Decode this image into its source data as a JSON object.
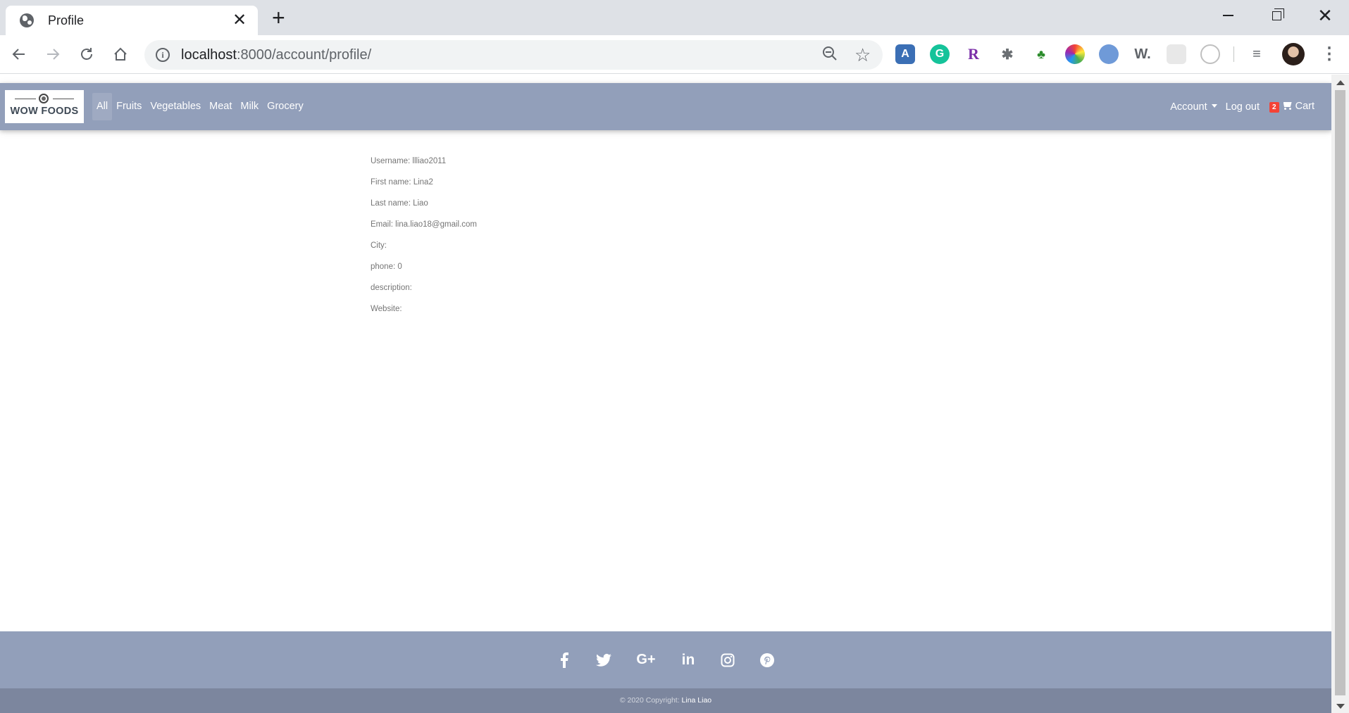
{
  "browser": {
    "tab_title": "Profile",
    "tab_close": "✕",
    "new_tab": "+",
    "url_host": "localhost",
    "url_rest": ":8000/account/profile/"
  },
  "site": {
    "brand": "WOW FOODS",
    "categories": [
      "All",
      "Fruits",
      "Vegetables",
      "Meat",
      "Milk",
      "Grocery"
    ],
    "account_label": "Account",
    "logout_label": "Log out",
    "cart_count": "2",
    "cart_label": "Cart"
  },
  "profile": {
    "username": "Username: llliao2011",
    "first_name": "First name: Lina2",
    "last_name": "Last name: Liao",
    "email": "Email: lina.liao18@gmail.com",
    "city": "City:",
    "phone": "phone: 0",
    "description": "description:",
    "website": "Website:"
  },
  "footer": {
    "social_icons": [
      "facebook-icon",
      "twitter-icon",
      "google-plus-icon",
      "linkedin-icon",
      "instagram-icon",
      "pinterest-icon"
    ],
    "copyright": "© 2020 Copyright: ",
    "author": "Lina Liao"
  },
  "colors": {
    "navbar": "#929fba",
    "footer_bottom": "#7c869e",
    "badge": "#f44336"
  }
}
